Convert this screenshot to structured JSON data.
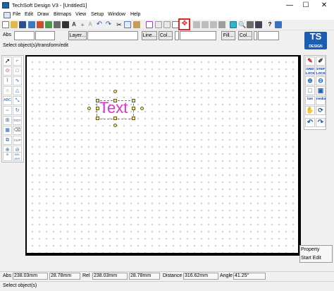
{
  "window": {
    "title": "TechSoft Design V3 - [Untitled1]",
    "minimize": "—",
    "maximize": "☐",
    "close": "✕"
  },
  "menu": {
    "items": [
      "File",
      "Edit",
      "Draw",
      "Bitmaps",
      "View",
      "Setup",
      "Window",
      "Help"
    ]
  },
  "toolbar2": {
    "abs_label": "Abs",
    "layer_button": "Layer...",
    "line_button": "Line...",
    "col_button_1": "Col...",
    "fill_button": "Fill...",
    "col_button_2": "Col..."
  },
  "hint": "Select object(s)/transform/edit",
  "logo": {
    "main": "TS",
    "sub": "DESIGN"
  },
  "canvas": {
    "text_object": "Text"
  },
  "left_tools": {
    "abc": "ABC",
    "tidy": "TIDY",
    "clip": "CLIP",
    "group": "in",
    "delete": "DEL ANY"
  },
  "right_tools": {
    "grid_lock": "GRID LOCK",
    "step_lock": "STEP LOCK",
    "last": "last",
    "media": "media"
  },
  "panel": {
    "property": "Property",
    "start_edit": "Start Edit"
  },
  "status": {
    "abs_label": "Abs",
    "abs_x": "238.03mm",
    "abs_y": "28.78mm",
    "rel_label": "Rel",
    "rel_x": "238.03mm",
    "rel_y": "28.78mm",
    "distance_label": "Distance",
    "distance": "316.62mm",
    "angle_label": "Angle",
    "angle": "41.25°"
  },
  "bottom_hint": "Select object(s)",
  "colors": {
    "text_object": "#e033d1",
    "highlight": "#e32626",
    "logo": "#1b5eb0"
  }
}
